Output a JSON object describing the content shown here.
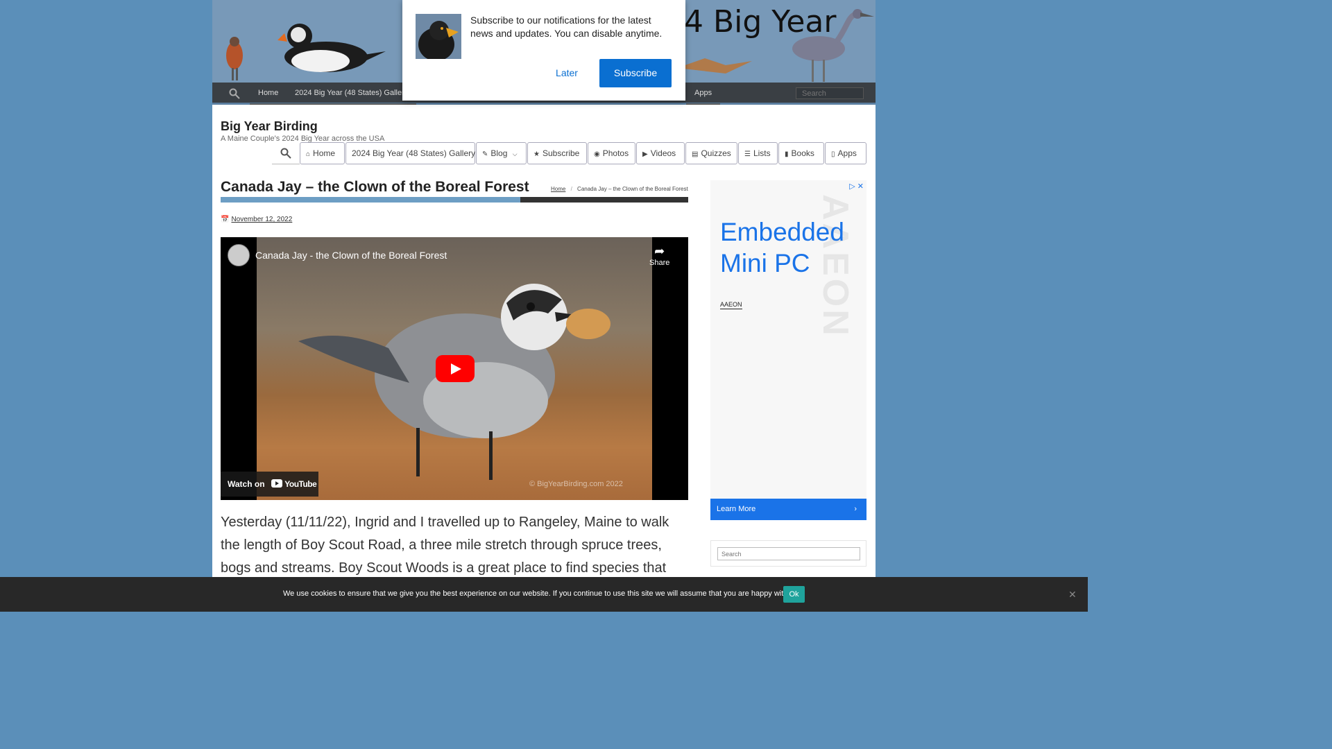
{
  "banner": {
    "text": "4 Big Year"
  },
  "topnav": {
    "items": [
      "Home",
      "2024 Big Year (48 States) Gallery",
      "Apps"
    ],
    "search_placeholder": "Search"
  },
  "site": {
    "title": "Big Year Birding",
    "tagline": "A Maine Couple's 2024 Big Year across the USA"
  },
  "menu": {
    "home": "Home",
    "gallery": "2024 Big Year (48 States) Gallery",
    "blog": "Blog",
    "subscribe": "Subscribe",
    "photos": "Photos",
    "videos": "Videos",
    "quizzes": "Quizzes",
    "lists": "Lists",
    "books": "Books",
    "apps": "Apps"
  },
  "article": {
    "title": "Canada Jay – the Clown of the Boreal Forest",
    "breadcrumb_home": "Home",
    "breadcrumb_sep": "/",
    "breadcrumb_current": "Canada Jay – the Clown of the Boreal Forest",
    "date": "November 12, 2022",
    "body": "Yesterday (11/11/22), Ingrid and I travelled up to Rangeley, Maine to walk the length of Boy Scout Road, a three mile stretch through spruce trees, bogs and streams. Boy Scout Woods is a great place to find species that live in the"
  },
  "video": {
    "title": "Canada Jay - the Clown of the Boreal Forest",
    "share_label": "Share",
    "watch_on": "Watch on",
    "youtube_label": "YouTube",
    "copyright": "© BigYearBirding.com 2022"
  },
  "ad": {
    "headline_line1": "Embedded",
    "headline_line2": "Mini PC",
    "brand": "AAEON",
    "watermark": "AAEON",
    "cta": "Learn More",
    "accent_color": "#1a73e8"
  },
  "sidebar": {
    "search_placeholder": "Search"
  },
  "popup": {
    "message": "Subscribe to our notifications for the latest news and updates. You can disable anytime.",
    "later_label": "Later",
    "subscribe_label": "Subscribe"
  },
  "cookie": {
    "text": "We use cookies to ensure that we give you the best experience on our website. If you continue to use this site we will assume that you are happy with it.",
    "ok_label": "Ok"
  }
}
